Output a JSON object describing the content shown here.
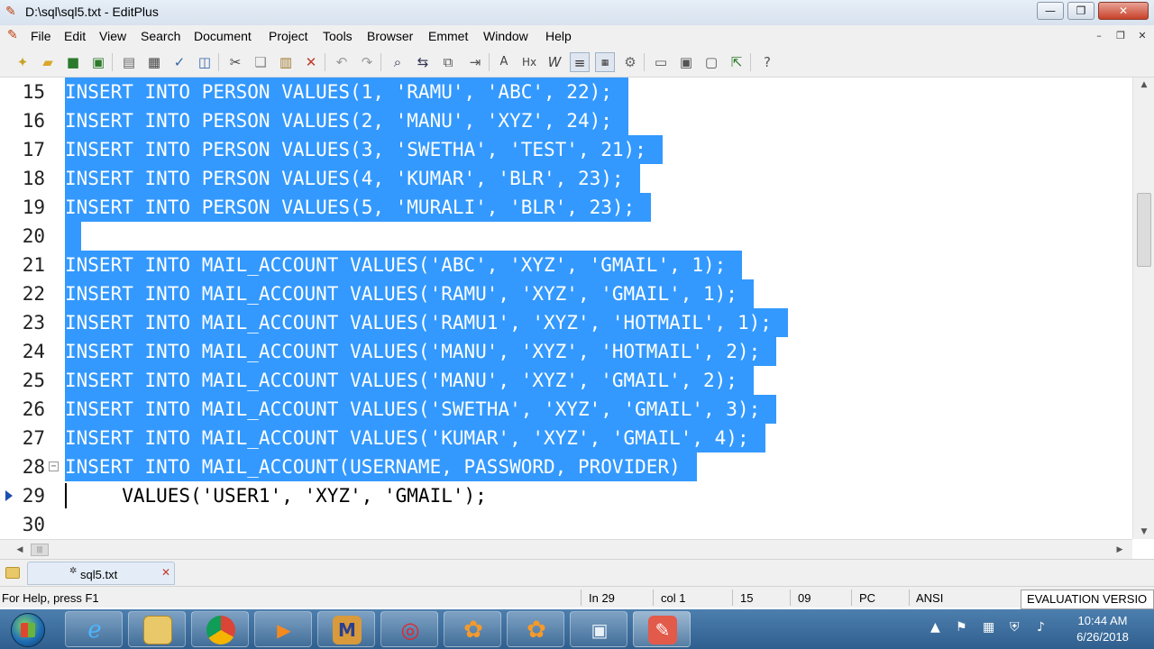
{
  "window": {
    "title": "D:\\sql\\sql5.txt - EditPlus"
  },
  "menu": [
    "File",
    "Edit",
    "View",
    "Search",
    "Document",
    "Project",
    "Tools",
    "Browser",
    "Emmet",
    "Window",
    "Help"
  ],
  "editor": {
    "lines": [
      {
        "n": "15",
        "text": "INSERT INTO PERSON VALUES(1, 'RAMU', 'ABC', 22);",
        "selected": true
      },
      {
        "n": "16",
        "text": "INSERT INTO PERSON VALUES(2, 'MANU', 'XYZ', 24);",
        "selected": true
      },
      {
        "n": "17",
        "text": "INSERT INTO PERSON VALUES(3, 'SWETHA', 'TEST', 21);",
        "selected": true
      },
      {
        "n": "18",
        "text": "INSERT INTO PERSON VALUES(4, 'KUMAR', 'BLR', 23);",
        "selected": true
      },
      {
        "n": "19",
        "text": "INSERT INTO PERSON VALUES(5, 'MURALI', 'BLR', 23);",
        "selected": true
      },
      {
        "n": "20",
        "text": "",
        "selected": true
      },
      {
        "n": "21",
        "text": "INSERT INTO MAIL_ACCOUNT VALUES('ABC', 'XYZ', 'GMAIL', 1);",
        "selected": true
      },
      {
        "n": "22",
        "text": "INSERT INTO MAIL_ACCOUNT VALUES('RAMU', 'XYZ', 'GMAIL', 1);",
        "selected": true
      },
      {
        "n": "23",
        "text": "INSERT INTO MAIL_ACCOUNT VALUES('RAMU1', 'XYZ', 'HOTMAIL', 1);",
        "selected": true
      },
      {
        "n": "24",
        "text": "INSERT INTO MAIL_ACCOUNT VALUES('MANU', 'XYZ', 'HOTMAIL', 2);",
        "selected": true
      },
      {
        "n": "25",
        "text": "INSERT INTO MAIL_ACCOUNT VALUES('MANU', 'XYZ', 'GMAIL', 2);",
        "selected": true
      },
      {
        "n": "26",
        "text": "INSERT INTO MAIL_ACCOUNT VALUES('SWETHA', 'XYZ', 'GMAIL', 3);",
        "selected": true
      },
      {
        "n": "27",
        "text": "INSERT INTO MAIL_ACCOUNT VALUES('KUMAR', 'XYZ', 'GMAIL', 4);",
        "selected": true
      },
      {
        "n": "28",
        "text": "INSERT INTO MAIL_ACCOUNT(USERNAME, PASSWORD, PROVIDER)",
        "selected": true
      },
      {
        "n": "29",
        "text": "     VALUES('USER1', 'XYZ', 'GMAIL');",
        "selected": false
      },
      {
        "n": "30",
        "text": "",
        "selected": false
      }
    ]
  },
  "tab": {
    "label": "sql5.txt"
  },
  "status": {
    "help": "For Help, press F1",
    "line": "In 29",
    "col": "col 1",
    "f1": "15",
    "f2": "09",
    "mode": "PC",
    "encoding": "ANSI",
    "evaluation": "EVALUATION VERSIO"
  },
  "clock": {
    "time": "10:44 AM",
    "date": "6/26/2018"
  },
  "colors": {
    "selection": "#3399ff",
    "taskbar": "#3a6b9c"
  }
}
